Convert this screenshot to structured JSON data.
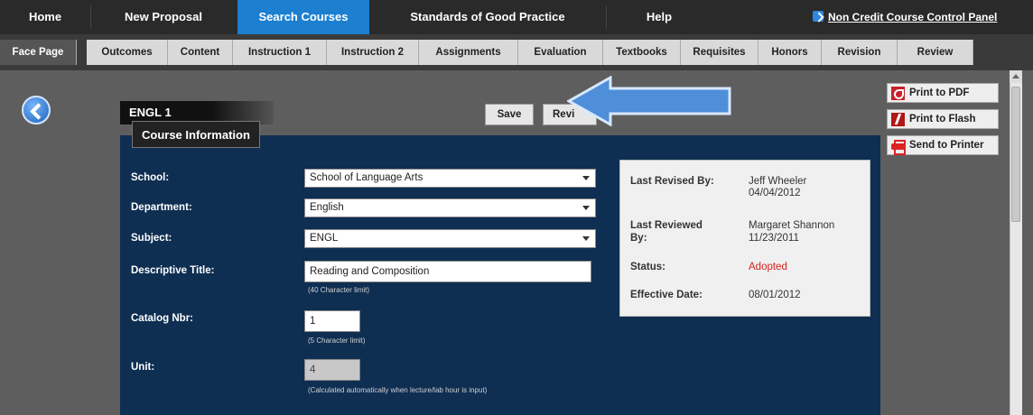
{
  "topnav": {
    "tabs": [
      {
        "label": "Home"
      },
      {
        "label": "New Proposal"
      },
      {
        "label": "Search Courses"
      },
      {
        "label": "Standards of Good Practice"
      },
      {
        "label": "Help"
      }
    ],
    "active": "Search Courses",
    "control_panel_link": "Non Credit Course Control Panel"
  },
  "subnav": {
    "tabs": [
      "Face Page",
      "Outcomes",
      "Content",
      "Instruction 1",
      "Instruction 2",
      "Assignments",
      "Evaluation",
      "Textbooks",
      "Requisites",
      "Honors",
      "Revision",
      "Review"
    ],
    "active": "Face Page"
  },
  "course": {
    "code": "ENGL 1",
    "save_label": "Save",
    "review_label": "Revi"
  },
  "panel": {
    "title": "Course Information",
    "fields": {
      "school_label": "School:",
      "school_value": "School of Language Arts",
      "department_label": "Department:",
      "department_value": "English",
      "subject_label": "Subject:",
      "subject_value": "ENGL",
      "title_label": "Descriptive Title:",
      "title_value": "Reading and Composition",
      "title_hint": "(40 Character limit)",
      "catalog_label": "Catalog Nbr:",
      "catalog_value": "1",
      "catalog_hint": "(5 Character limit)",
      "unit_label": "Unit:",
      "unit_value": "4",
      "unit_hint": "(Calculated automatically when lecture/lab hour is input)"
    }
  },
  "info": {
    "last_revised_label": "Last Revised By:",
    "last_revised_name": "Jeff Wheeler",
    "last_revised_date": "04/04/2012",
    "last_reviewed_label_1": "Last Reviewed",
    "last_reviewed_label_2": "By:",
    "last_reviewed_name": "Margaret Shannon",
    "last_reviewed_date": "11/23/2011",
    "status_label": "Status:",
    "status_value": "Adopted",
    "effective_label": "Effective Date:",
    "effective_value": "08/01/2012"
  },
  "actions": {
    "print_pdf": "Print to PDF",
    "print_flash": "Print to Flash",
    "send_printer": "Send to Printer"
  },
  "colors": {
    "accent": "#1c7fd0",
    "panel": "#0e2e52",
    "status": "#d42020"
  }
}
